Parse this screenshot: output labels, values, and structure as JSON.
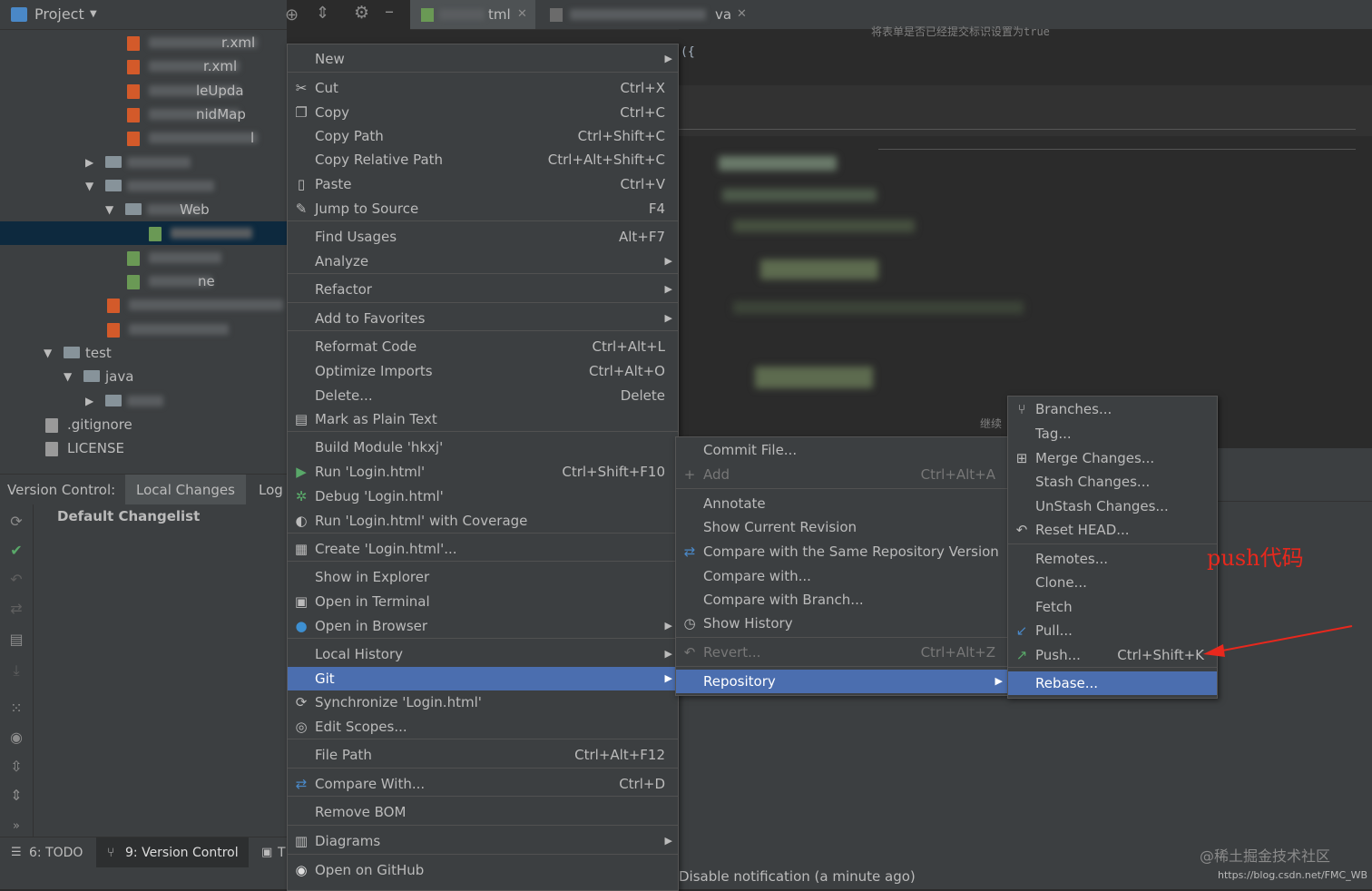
{
  "project_panel": {
    "title": "Project",
    "tree": [
      {
        "text": "r.xml",
        "kind": "file"
      },
      {
        "text": "r.xml",
        "kind": "file"
      },
      {
        "text": "leUpda",
        "kind": "file"
      },
      {
        "text": "nidMap",
        "kind": "file"
      },
      {
        "text": "l",
        "kind": "file"
      },
      {
        "text": "",
        "kind": "folder"
      },
      {
        "text": "",
        "kind": "folder"
      },
      {
        "text": "Web",
        "kind": "folder"
      },
      {
        "text": "",
        "kind": "file"
      },
      {
        "text": "",
        "kind": "file"
      },
      {
        "text": "ne",
        "kind": "file"
      },
      {
        "text": "",
        "kind": "file"
      },
      {
        "text": "",
        "kind": "file"
      },
      {
        "text": "test",
        "kind": "folder"
      },
      {
        "text": "java",
        "kind": "folder"
      },
      {
        "text": "",
        "kind": "folder"
      },
      {
        "text": ".gitignore",
        "kind": "file"
      },
      {
        "text": "LICENSE",
        "kind": "file"
      }
    ]
  },
  "editor_tabs": [
    {
      "label": "tml"
    },
    {
      "label": "va"
    }
  ],
  "editor_comment": "将表单是否已经提交标识设置为true",
  "editor_fragment_1": "({",
  "editor_fragment_2": "继续",
  "version_control": {
    "label": "Version Control:",
    "tabs": [
      "Local Changes",
      "Log"
    ],
    "changelist": "Default Changelist"
  },
  "bottom_tabs": [
    {
      "label": "6: TODO"
    },
    {
      "label": "9: Version Control"
    },
    {
      "label": "T"
    }
  ],
  "notification": "Disable notification (a minute ago)",
  "context_menu": {
    "items": [
      {
        "label": "New",
        "shortcut": "",
        "submenu": true
      },
      {
        "label": "Cut",
        "shortcut": "Ctrl+X",
        "icon": "cut-icon"
      },
      {
        "label": "Copy",
        "shortcut": "Ctrl+C",
        "icon": "copy-icon"
      },
      {
        "label": "Copy Path",
        "shortcut": "Ctrl+Shift+C"
      },
      {
        "label": "Copy Relative Path",
        "shortcut": "Ctrl+Alt+Shift+C"
      },
      {
        "label": "Paste",
        "shortcut": "Ctrl+V",
        "icon": "paste-icon"
      },
      {
        "label": "Jump to Source",
        "shortcut": "F4",
        "icon": "jump-icon"
      },
      {
        "label": "Find Usages",
        "shortcut": "Alt+F7"
      },
      {
        "label": "Analyze",
        "shortcut": "",
        "submenu": true
      },
      {
        "label": "Refactor",
        "shortcut": "",
        "submenu": true
      },
      {
        "label": "Add to Favorites",
        "shortcut": "",
        "submenu": true
      },
      {
        "label": "Reformat Code",
        "shortcut": "Ctrl+Alt+L"
      },
      {
        "label": "Optimize Imports",
        "shortcut": "Ctrl+Alt+O"
      },
      {
        "label": "Delete...",
        "shortcut": "Delete"
      },
      {
        "label": "Mark as Plain Text",
        "shortcut": "",
        "icon": "plain-text-icon"
      },
      {
        "label": "Build Module 'hkxj'",
        "shortcut": ""
      },
      {
        "label": "Run 'Login.html'",
        "shortcut": "Ctrl+Shift+F10",
        "icon": "run-icon"
      },
      {
        "label": "Debug 'Login.html'",
        "shortcut": "",
        "icon": "debug-icon"
      },
      {
        "label": "Run 'Login.html' with Coverage",
        "shortcut": "",
        "icon": "coverage-icon"
      },
      {
        "label": "Create 'Login.html'...",
        "shortcut": "",
        "icon": "create-config-icon"
      },
      {
        "label": "Show in Explorer",
        "shortcut": ""
      },
      {
        "label": "Open in Terminal",
        "shortcut": "",
        "icon": "terminal-icon"
      },
      {
        "label": "Open in Browser",
        "shortcut": "",
        "submenu": true,
        "icon": "globe-icon"
      },
      {
        "label": "Local History",
        "shortcut": "",
        "submenu": true
      },
      {
        "label": "Git",
        "shortcut": "",
        "submenu": true,
        "selected": true
      },
      {
        "label": "Synchronize 'Login.html'",
        "shortcut": "",
        "icon": "sync-icon"
      },
      {
        "label": "Edit Scopes...",
        "shortcut": "",
        "icon": "scopes-icon"
      },
      {
        "label": "File Path",
        "shortcut": "Ctrl+Alt+F12"
      },
      {
        "label": "Compare With...",
        "shortcut": "Ctrl+D",
        "icon": "compare-icon"
      },
      {
        "label": "Remove BOM",
        "shortcut": ""
      },
      {
        "label": "Diagrams",
        "shortcut": "",
        "submenu": true,
        "icon": "diagram-icon"
      },
      {
        "label": "Open on GitHub",
        "shortcut": "",
        "icon": "github-icon"
      }
    ]
  },
  "git_menu": {
    "items": [
      {
        "label": "Commit File...",
        "shortcut": ""
      },
      {
        "label": "Add",
        "shortcut": "Ctrl+Alt+A",
        "disabled": true,
        "icon": "plus-icon"
      },
      {
        "label": "Annotate",
        "shortcut": ""
      },
      {
        "label": "Show Current Revision",
        "shortcut": ""
      },
      {
        "label": "Compare with the Same Repository Version",
        "shortcut": "",
        "icon": "compare-icon"
      },
      {
        "label": "Compare with...",
        "shortcut": ""
      },
      {
        "label": "Compare with Branch...",
        "shortcut": ""
      },
      {
        "label": "Show History",
        "shortcut": "",
        "icon": "clock-icon"
      },
      {
        "label": "Revert...",
        "shortcut": "Ctrl+Alt+Z",
        "disabled": true,
        "icon": "revert-icon"
      },
      {
        "label": "Repository",
        "shortcut": "",
        "submenu": true,
        "selected": true
      }
    ]
  },
  "repository_menu": {
    "items": [
      {
        "label": "Branches...",
        "shortcut": "",
        "icon": "branch-icon"
      },
      {
        "label": "Tag...",
        "shortcut": ""
      },
      {
        "label": "Merge Changes...",
        "shortcut": "",
        "icon": "merge-icon"
      },
      {
        "label": "Stash Changes...",
        "shortcut": ""
      },
      {
        "label": "UnStash Changes...",
        "shortcut": ""
      },
      {
        "label": "Reset HEAD...",
        "shortcut": "",
        "icon": "reset-icon"
      },
      {
        "label": "Remotes...",
        "shortcut": ""
      },
      {
        "label": "Clone...",
        "shortcut": ""
      },
      {
        "label": "Fetch",
        "shortcut": ""
      },
      {
        "label": "Pull...",
        "shortcut": "",
        "icon": "pull-icon"
      },
      {
        "label": "Push...",
        "shortcut": "Ctrl+Shift+K",
        "icon": "push-icon"
      },
      {
        "label": "Rebase...",
        "shortcut": "",
        "selected": true
      }
    ]
  },
  "annotation": {
    "text": "push代码",
    "color": "#e8281d"
  },
  "watermark": {
    "community": "@稀土掘金技术社区",
    "url": "https://blog.csdn.net/FMC_WB"
  }
}
